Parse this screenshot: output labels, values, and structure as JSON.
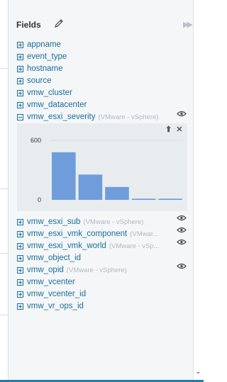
{
  "panel": {
    "title": "Fields",
    "pencil_icon": "pencil-icon",
    "collapse_icon": "double-chevron-right-icon"
  },
  "fields": [
    {
      "name": "appname",
      "source": "",
      "expanded": false,
      "eye": false
    },
    {
      "name": "event_type",
      "source": "",
      "expanded": false,
      "eye": false
    },
    {
      "name": "hostname",
      "source": "",
      "expanded": false,
      "eye": false
    },
    {
      "name": "source",
      "source": "",
      "expanded": false,
      "eye": false
    },
    {
      "name": "vmw_cluster",
      "source": "",
      "expanded": false,
      "eye": false
    },
    {
      "name": "vmw_datacenter",
      "source": "",
      "expanded": false,
      "eye": false
    },
    {
      "name": "vmw_esxi_severity",
      "source": "(VMware - vSphere)",
      "expanded": true,
      "eye": true
    },
    {
      "name": "vmw_esxi_sub",
      "source": "(VMware - vSphere)",
      "expanded": false,
      "eye": true
    },
    {
      "name": "vmw_esxi_vmk_component",
      "source": "(VMwar...",
      "expanded": false,
      "eye": true
    },
    {
      "name": "vmw_esxi_vmk_world",
      "source": "(VMware - vSp...",
      "expanded": false,
      "eye": true
    },
    {
      "name": "vmw_object_id",
      "source": "",
      "expanded": false,
      "eye": false
    },
    {
      "name": "vmw_opid",
      "source": "(VMware - vSphere)",
      "expanded": false,
      "eye": true
    },
    {
      "name": "vmw_vcenter",
      "source": "",
      "expanded": false,
      "eye": false
    },
    {
      "name": "vmw_vcenter_id",
      "source": "",
      "expanded": false,
      "eye": false
    },
    {
      "name": "vmw_vr_ops_id",
      "source": "",
      "expanded": false,
      "eye": false
    }
  ],
  "colors": {
    "bar": "#6f9ddc",
    "link": "#1a6f99"
  },
  "chart_data": {
    "type": "bar",
    "title": "",
    "xlabel": "",
    "ylabel": "",
    "ytick_labels": [
      "600",
      "0"
    ],
    "ylim": [
      0,
      600
    ],
    "categories": [
      "",
      "",
      "",
      "",
      ""
    ],
    "values": [
      480,
      255,
      130,
      12,
      12
    ]
  }
}
